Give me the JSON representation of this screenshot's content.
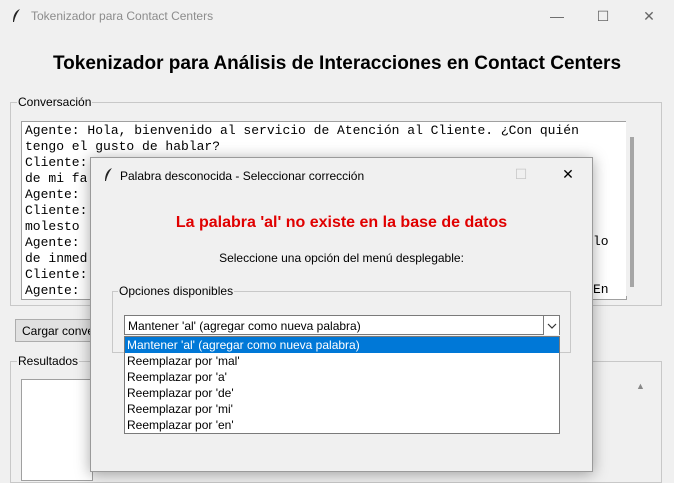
{
  "window": {
    "title": "Tokenizador para Contact Centers",
    "minimize_symbol": "—",
    "maximize_symbol": "☐",
    "close_symbol": "✕"
  },
  "heading": "Tokenizador para Análisis de Interacciones en Contact Centers",
  "conversation": {
    "label": "Conversación",
    "lines": [
      "Agente: Hola, bienvenido al servicio de Atención al Cliente. ¿Con quién",
      "tengo el gusto de hablar?",
      "Cliente:                                                         erca",
      "de mi fa",
      "Agente: ",
      "Cliente:",
      "molesto ",
      "Agente: ",
      "de inmed",
      "Cliente:",
      "Agente: "
    ],
    "right_fragments": {
      "line7": "lo",
      "line11": "En"
    }
  },
  "load_button": {
    "label": "Cargar conve"
  },
  "results": {
    "label": "Resultados"
  },
  "dialog": {
    "title": "Palabra desconocida - Seleccionar corrección",
    "error": "La palabra 'al' no existe en la base de datos",
    "instruction": "Seleccione una opción del menú desplegable:",
    "options_label": "Opciones disponibles",
    "selected": "Mantener 'al' (agregar como nueva palabra)",
    "options": [
      "Mantener 'al' (agregar como nueva palabra)",
      "Reemplazar por 'mal'",
      "Reemplazar por 'a'",
      "Reemplazar por 'de'",
      "Reemplazar por 'mi'",
      "Reemplazar por 'en'"
    ],
    "maximize_symbol": "☐",
    "close_symbol": "✕"
  },
  "colors": {
    "error": "#e00000",
    "selection": "#0078d7"
  }
}
